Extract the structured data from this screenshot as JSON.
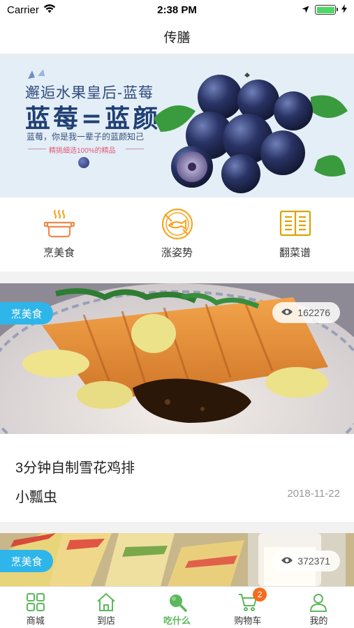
{
  "status_bar": {
    "carrier": "Carrier",
    "time": "2:38 PM",
    "battery_level": 1.0
  },
  "nav": {
    "title": "传膳"
  },
  "banner": {
    "line1": "邂逅水果皇后-蓝莓",
    "line2": "蓝莓=蓝颜",
    "line3": "蓝莓，你是我一辈子的蓝颜知己",
    "line4": "精挑细选100%的精品"
  },
  "categories": [
    {
      "label": "烹美食",
      "icon": "cooking-pot-icon"
    },
    {
      "label": "涨姿势",
      "icon": "fish-plate-icon"
    },
    {
      "label": "翻菜谱",
      "icon": "recipe-book-icon"
    }
  ],
  "cards": [
    {
      "badge": "烹美食",
      "views": "162276",
      "title": "3分钟自制雪花鸡排",
      "author": "小瓢虫",
      "date": "2018-11-22"
    },
    {
      "badge": "烹美食",
      "views": "372371"
    }
  ],
  "tabs": [
    {
      "label": "商城",
      "icon": "grid-icon",
      "active": false
    },
    {
      "label": "到店",
      "icon": "home-icon",
      "active": false
    },
    {
      "label": "吃什么",
      "icon": "magnifier-icon",
      "active": true
    },
    {
      "label": "购物车",
      "icon": "cart-icon",
      "active": false,
      "badge": "2"
    },
    {
      "label": "我的",
      "icon": "user-icon",
      "active": false
    }
  ],
  "colors": {
    "accent_green": "#5cb85c",
    "badge_blue": "#2eb5ea",
    "cart_badge": "#f56c1f",
    "category_orange": "#f5a623",
    "category_gold": "#d9a400"
  }
}
